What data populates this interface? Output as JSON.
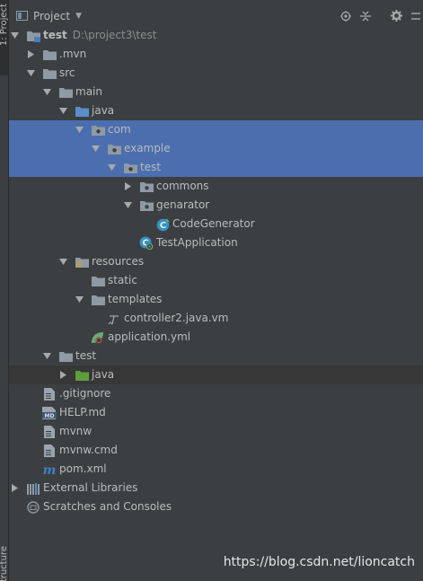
{
  "window": {
    "side_tab_label": "1: Project",
    "side_tab_bottom_label": "Structure"
  },
  "header": {
    "title": "Project"
  },
  "tree": [
    {
      "label": "test",
      "sub": "D:\\project3\\test",
      "depth": 0,
      "expand": "open",
      "icon": "module-folder-icon",
      "state": ""
    },
    {
      "label": ".mvn",
      "depth": 1,
      "expand": "closed",
      "icon": "folder-icon",
      "state": ""
    },
    {
      "label": "src",
      "depth": 1,
      "expand": "open",
      "icon": "folder-icon",
      "state": ""
    },
    {
      "label": "main",
      "depth": 2,
      "expand": "open",
      "icon": "folder-icon",
      "state": ""
    },
    {
      "label": "java",
      "depth": 3,
      "expand": "open",
      "icon": "source-folder-icon",
      "state": ""
    },
    {
      "label": "com",
      "depth": 4,
      "expand": "open",
      "icon": "package-icon",
      "state": "selected"
    },
    {
      "label": "example",
      "depth": 5,
      "expand": "open",
      "icon": "package-icon",
      "state": "selected"
    },
    {
      "label": "test",
      "depth": 6,
      "expand": "open",
      "icon": "package-icon",
      "state": "selected"
    },
    {
      "label": "commons",
      "depth": 7,
      "expand": "closed",
      "icon": "package-icon",
      "state": ""
    },
    {
      "label": "genarator",
      "depth": 7,
      "expand": "open",
      "icon": "package-icon",
      "state": ""
    },
    {
      "label": "CodeGenerator",
      "depth": 8,
      "expand": "none",
      "icon": "java-class-icon",
      "state": ""
    },
    {
      "label": "TestApplication",
      "depth": 7,
      "expand": "none",
      "icon": "spring-boot-class-icon",
      "state": ""
    },
    {
      "label": "resources",
      "depth": 3,
      "expand": "open",
      "icon": "resources-folder-icon",
      "state": ""
    },
    {
      "label": "static",
      "depth": 4,
      "expand": "none",
      "icon": "folder-icon",
      "state": ""
    },
    {
      "label": "templates",
      "depth": 4,
      "expand": "open",
      "icon": "folder-icon",
      "state": ""
    },
    {
      "label": "controller2.java.vm",
      "depth": 5,
      "expand": "none",
      "icon": "velocity-file-icon",
      "state": ""
    },
    {
      "label": "application.yml",
      "depth": 4,
      "expand": "none",
      "icon": "spring-yml-icon",
      "state": ""
    },
    {
      "label": "test",
      "depth": 2,
      "expand": "open",
      "icon": "folder-icon",
      "state": ""
    },
    {
      "label": "java",
      "depth": 3,
      "expand": "closed",
      "icon": "test-source-folder-icon",
      "state": "current"
    },
    {
      "label": ".gitignore",
      "depth": 1,
      "expand": "none",
      "icon": "text-file-icon",
      "state": ""
    },
    {
      "label": "HELP.md",
      "depth": 1,
      "expand": "none",
      "icon": "markdown-file-icon",
      "state": ""
    },
    {
      "label": "mvnw",
      "depth": 1,
      "expand": "none",
      "icon": "text-file-icon",
      "state": ""
    },
    {
      "label": "mvnw.cmd",
      "depth": 1,
      "expand": "none",
      "icon": "text-file-icon",
      "state": ""
    },
    {
      "label": "pom.xml",
      "depth": 1,
      "expand": "none",
      "icon": "maven-icon",
      "state": ""
    },
    {
      "label": "External Libraries",
      "depth": 0,
      "expand": "closed",
      "icon": "libraries-icon",
      "state": ""
    },
    {
      "label": "Scratches and Consoles",
      "depth": 0,
      "expand": "none",
      "icon": "scratches-icon",
      "state": ""
    }
  ],
  "watermark": "https://blog.csdn.net/lioncatch",
  "colors": {
    "background": "#3c3f41",
    "selection": "#4b6eaf",
    "folder": "#8f9aa4",
    "source_folder": "#5b8dc9",
    "test_folder": "#5f9d3b",
    "java_class": "#3592c4",
    "text": "#bbbbbb"
  }
}
